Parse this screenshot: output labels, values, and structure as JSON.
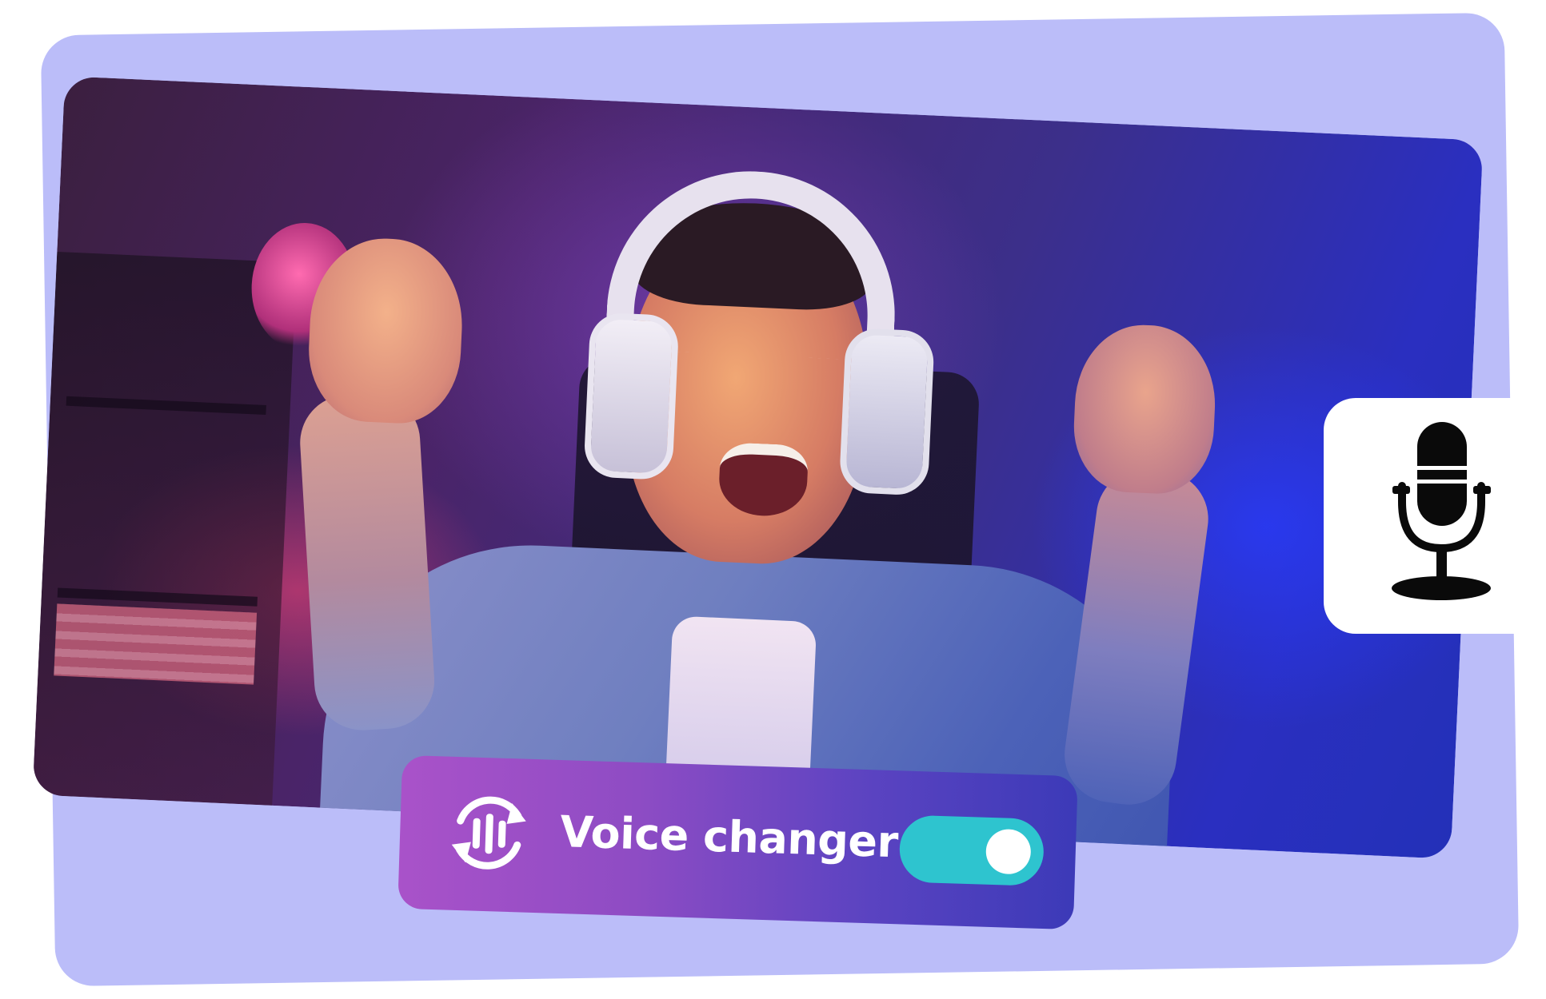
{
  "voice_changer": {
    "label": "Voice changer",
    "toggle_on": true,
    "toggle_color": "#2ec4cf",
    "icon": "waveform-cycle-icon",
    "gradient": [
      "#a952c9",
      "#3c3ab8"
    ]
  },
  "mic_card": {
    "icon": "microphone-icon"
  },
  "colors": {
    "backdrop": "#bbbdf9",
    "card": "#ffffff"
  }
}
